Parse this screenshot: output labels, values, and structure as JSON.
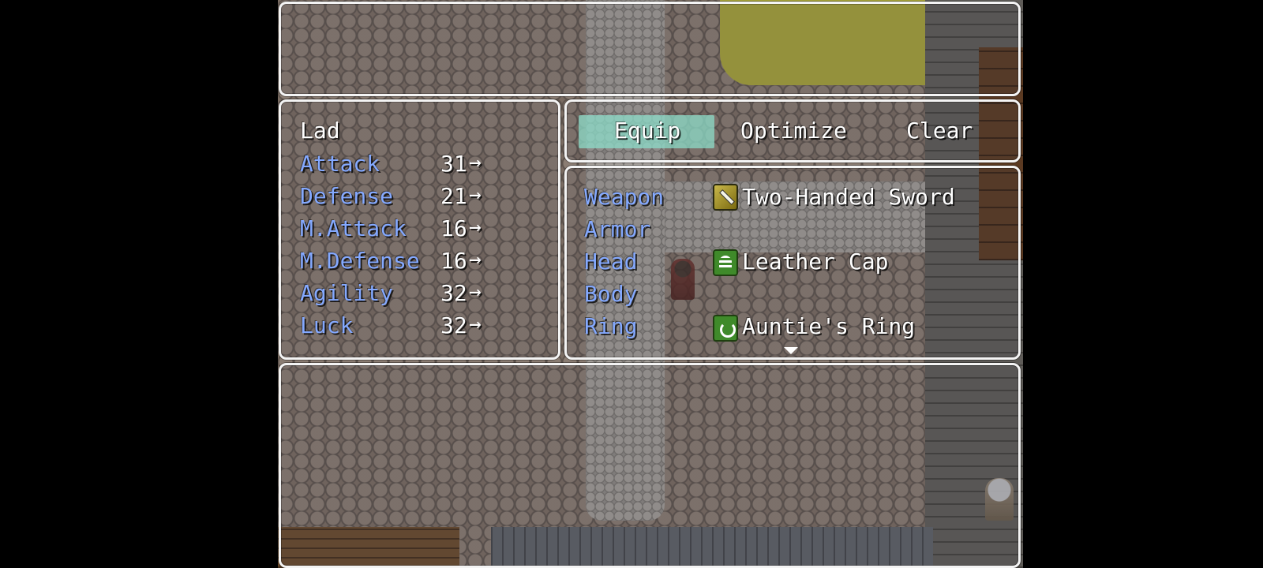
{
  "actor": {
    "name": "Lad"
  },
  "stats": [
    {
      "label": "Attack",
      "value": "31",
      "arrow": "→"
    },
    {
      "label": "Defense",
      "value": "21",
      "arrow": "→"
    },
    {
      "label": "M.Attack",
      "value": "16",
      "arrow": "→"
    },
    {
      "label": "M.Defense",
      "value": "16",
      "arrow": "→"
    },
    {
      "label": "Agility",
      "value": "32",
      "arrow": "→"
    },
    {
      "label": "Luck",
      "value": "32",
      "arrow": "→"
    }
  ],
  "commands": [
    {
      "label": "Equip",
      "selected": true
    },
    {
      "label": "Optimize",
      "selected": false
    },
    {
      "label": "Clear",
      "selected": false
    }
  ],
  "slots": [
    {
      "slot": "Weapon",
      "item": "Two-Handed Sword",
      "icon": "sword-icon"
    },
    {
      "slot": "Armor",
      "item": "",
      "icon": ""
    },
    {
      "slot": "Head",
      "item": "Leather Cap",
      "icon": "cap-icon"
    },
    {
      "slot": "Body",
      "item": "",
      "icon": ""
    },
    {
      "slot": "Ring",
      "item": "Auntie's Ring",
      "icon": "ring-icon"
    }
  ],
  "help": {
    "text": ""
  },
  "colors": {
    "system_text": "#84a9ff",
    "normal_text": "#ffffff",
    "window_border": "#f4f4f4",
    "highlight": "#8cdcc8"
  }
}
